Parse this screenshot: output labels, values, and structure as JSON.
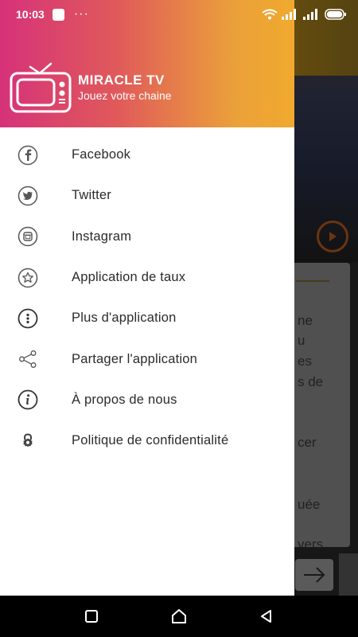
{
  "status_bar": {
    "time": "10:03",
    "dots": "···"
  },
  "drawer": {
    "app_name": "MIRACLE TV",
    "tagline": "Jouez votre chaine",
    "items": [
      {
        "label": "Facebook",
        "icon": "facebook-icon"
      },
      {
        "label": "Twitter",
        "icon": "twitter-icon"
      },
      {
        "label": "Instagram",
        "icon": "instagram-icon"
      },
      {
        "label": "Application de taux",
        "icon": "star-icon"
      },
      {
        "label": "Plus d'application",
        "icon": "more-icon"
      },
      {
        "label": "Partager l'application",
        "icon": "share-icon"
      },
      {
        "label": "À propos de nous",
        "icon": "info-icon"
      },
      {
        "label": "Politique de confidentialité",
        "icon": "lock-icon"
      }
    ]
  },
  "background": {
    "snippets": [
      "ne",
      "u",
      "es",
      "s de",
      "cer",
      "uée",
      "vers"
    ]
  },
  "colors": {
    "header_start": "#d6327a",
    "header_end": "#f0a92e",
    "accent": "#c4601d"
  }
}
